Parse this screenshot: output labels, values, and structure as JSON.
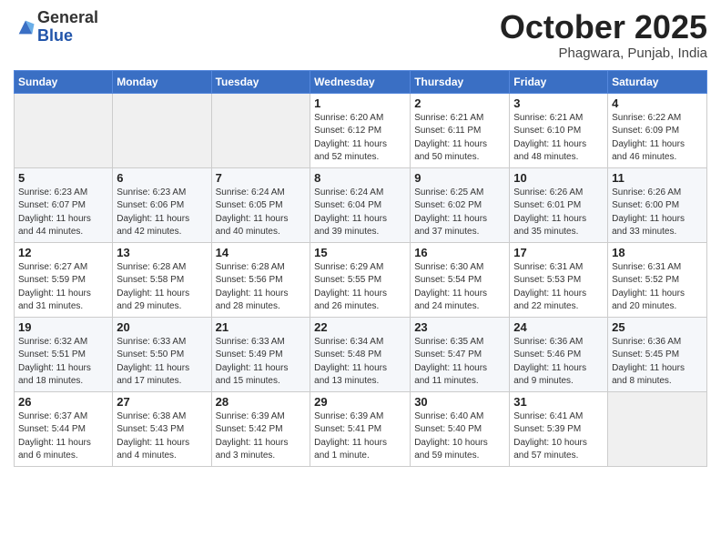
{
  "header": {
    "logo_general": "General",
    "logo_blue": "Blue",
    "month": "October 2025",
    "location": "Phagwara, Punjab, India"
  },
  "days_of_week": [
    "Sunday",
    "Monday",
    "Tuesday",
    "Wednesday",
    "Thursday",
    "Friday",
    "Saturday"
  ],
  "weeks": [
    [
      {
        "day": "",
        "info": ""
      },
      {
        "day": "",
        "info": ""
      },
      {
        "day": "",
        "info": ""
      },
      {
        "day": "1",
        "info": "Sunrise: 6:20 AM\nSunset: 6:12 PM\nDaylight: 11 hours\nand 52 minutes."
      },
      {
        "day": "2",
        "info": "Sunrise: 6:21 AM\nSunset: 6:11 PM\nDaylight: 11 hours\nand 50 minutes."
      },
      {
        "day": "3",
        "info": "Sunrise: 6:21 AM\nSunset: 6:10 PM\nDaylight: 11 hours\nand 48 minutes."
      },
      {
        "day": "4",
        "info": "Sunrise: 6:22 AM\nSunset: 6:09 PM\nDaylight: 11 hours\nand 46 minutes."
      }
    ],
    [
      {
        "day": "5",
        "info": "Sunrise: 6:23 AM\nSunset: 6:07 PM\nDaylight: 11 hours\nand 44 minutes."
      },
      {
        "day": "6",
        "info": "Sunrise: 6:23 AM\nSunset: 6:06 PM\nDaylight: 11 hours\nand 42 minutes."
      },
      {
        "day": "7",
        "info": "Sunrise: 6:24 AM\nSunset: 6:05 PM\nDaylight: 11 hours\nand 40 minutes."
      },
      {
        "day": "8",
        "info": "Sunrise: 6:24 AM\nSunset: 6:04 PM\nDaylight: 11 hours\nand 39 minutes."
      },
      {
        "day": "9",
        "info": "Sunrise: 6:25 AM\nSunset: 6:02 PM\nDaylight: 11 hours\nand 37 minutes."
      },
      {
        "day": "10",
        "info": "Sunrise: 6:26 AM\nSunset: 6:01 PM\nDaylight: 11 hours\nand 35 minutes."
      },
      {
        "day": "11",
        "info": "Sunrise: 6:26 AM\nSunset: 6:00 PM\nDaylight: 11 hours\nand 33 minutes."
      }
    ],
    [
      {
        "day": "12",
        "info": "Sunrise: 6:27 AM\nSunset: 5:59 PM\nDaylight: 11 hours\nand 31 minutes."
      },
      {
        "day": "13",
        "info": "Sunrise: 6:28 AM\nSunset: 5:58 PM\nDaylight: 11 hours\nand 29 minutes."
      },
      {
        "day": "14",
        "info": "Sunrise: 6:28 AM\nSunset: 5:56 PM\nDaylight: 11 hours\nand 28 minutes."
      },
      {
        "day": "15",
        "info": "Sunrise: 6:29 AM\nSunset: 5:55 PM\nDaylight: 11 hours\nand 26 minutes."
      },
      {
        "day": "16",
        "info": "Sunrise: 6:30 AM\nSunset: 5:54 PM\nDaylight: 11 hours\nand 24 minutes."
      },
      {
        "day": "17",
        "info": "Sunrise: 6:31 AM\nSunset: 5:53 PM\nDaylight: 11 hours\nand 22 minutes."
      },
      {
        "day": "18",
        "info": "Sunrise: 6:31 AM\nSunset: 5:52 PM\nDaylight: 11 hours\nand 20 minutes."
      }
    ],
    [
      {
        "day": "19",
        "info": "Sunrise: 6:32 AM\nSunset: 5:51 PM\nDaylight: 11 hours\nand 18 minutes."
      },
      {
        "day": "20",
        "info": "Sunrise: 6:33 AM\nSunset: 5:50 PM\nDaylight: 11 hours\nand 17 minutes."
      },
      {
        "day": "21",
        "info": "Sunrise: 6:33 AM\nSunset: 5:49 PM\nDaylight: 11 hours\nand 15 minutes."
      },
      {
        "day": "22",
        "info": "Sunrise: 6:34 AM\nSunset: 5:48 PM\nDaylight: 11 hours\nand 13 minutes."
      },
      {
        "day": "23",
        "info": "Sunrise: 6:35 AM\nSunset: 5:47 PM\nDaylight: 11 hours\nand 11 minutes."
      },
      {
        "day": "24",
        "info": "Sunrise: 6:36 AM\nSunset: 5:46 PM\nDaylight: 11 hours\nand 9 minutes."
      },
      {
        "day": "25",
        "info": "Sunrise: 6:36 AM\nSunset: 5:45 PM\nDaylight: 11 hours\nand 8 minutes."
      }
    ],
    [
      {
        "day": "26",
        "info": "Sunrise: 6:37 AM\nSunset: 5:44 PM\nDaylight: 11 hours\nand 6 minutes."
      },
      {
        "day": "27",
        "info": "Sunrise: 6:38 AM\nSunset: 5:43 PM\nDaylight: 11 hours\nand 4 minutes."
      },
      {
        "day": "28",
        "info": "Sunrise: 6:39 AM\nSunset: 5:42 PM\nDaylight: 11 hours\nand 3 minutes."
      },
      {
        "day": "29",
        "info": "Sunrise: 6:39 AM\nSunset: 5:41 PM\nDaylight: 11 hours\nand 1 minute."
      },
      {
        "day": "30",
        "info": "Sunrise: 6:40 AM\nSunset: 5:40 PM\nDaylight: 10 hours\nand 59 minutes."
      },
      {
        "day": "31",
        "info": "Sunrise: 6:41 AM\nSunset: 5:39 PM\nDaylight: 10 hours\nand 57 minutes."
      },
      {
        "day": "",
        "info": ""
      }
    ]
  ]
}
